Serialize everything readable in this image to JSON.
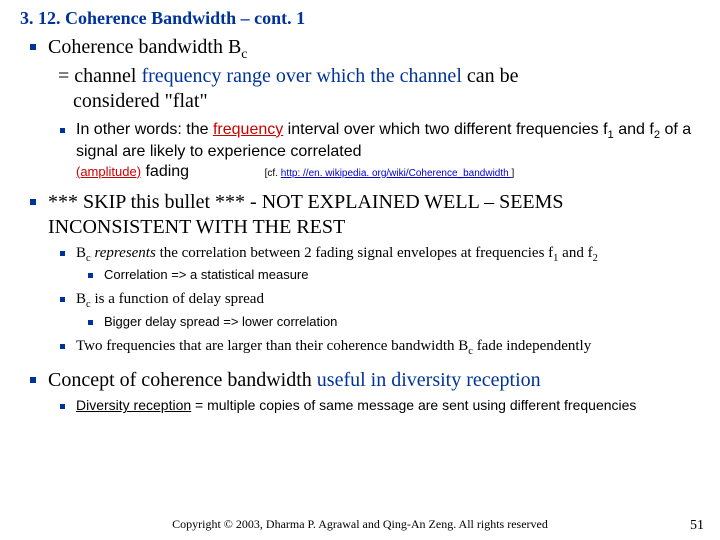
{
  "title": "3. 12. Coherence Bandwidth – cont. 1",
  "bullet1_a": "Coherence bandwidth B",
  "bullet1_sub": "c",
  "bullet1_b": "= channel ",
  "bullet1_c": "frequency range over which the channel",
  "bullet1_d": " can be",
  "bullet1_e": "considered \"flat\"",
  "bullet1_1_a": "In other words: the ",
  "bullet1_1_freq": "frequency",
  "bullet1_1_b": " interval over which two different frequencies f",
  "bullet1_1_c": " and f",
  "bullet1_1_d": " of a signal are likely to experience correlated",
  "bullet1_1_amp": "(amplitude)",
  "bullet1_1_fade": " fading",
  "bullet1_1_cite_a": "[cf. ",
  "bullet1_1_cite_link": "http: //en. wikipedia. org/wiki/Coherence_bandwidth ",
  "bullet1_1_cite_b": "]",
  "sub1": "1",
  "sub2": "2",
  "bullet2": "*** SKIP this bullet *** - NOT EXPLAINED WELL – SEEMS INCONSISTENT WITH THE REST",
  "bullet2_1_a": "B",
  "bullet2_1_b": " represents",
  "bullet2_1_c": " the correlation between 2 fading signal envelopes at frequencies f",
  "bullet2_1_d": " and f",
  "bullet2_1_1": "Correlation => a statistical measure",
  "bullet2_2_a": "B",
  "bullet2_2_b": " is a function of delay spread",
  "bullet2_2_1": "Bigger delay spread => lower correlation",
  "bullet2_3_a": "Two frequencies that are larger than their coherence bandwidth B",
  "bullet2_3_b": " fade independently",
  "bullet3_a": "Concept of coherence bandwidth ",
  "bullet3_b": "useful in diversity reception",
  "bullet3_1_a": "Diversity reception",
  "bullet3_1_b": " = multiple copies of same message are sent using different frequencies",
  "footer": "Copyright © 2003, Dharma P. Agrawal and Qing-An Zeng. All rights reserved",
  "pagenum": "51"
}
